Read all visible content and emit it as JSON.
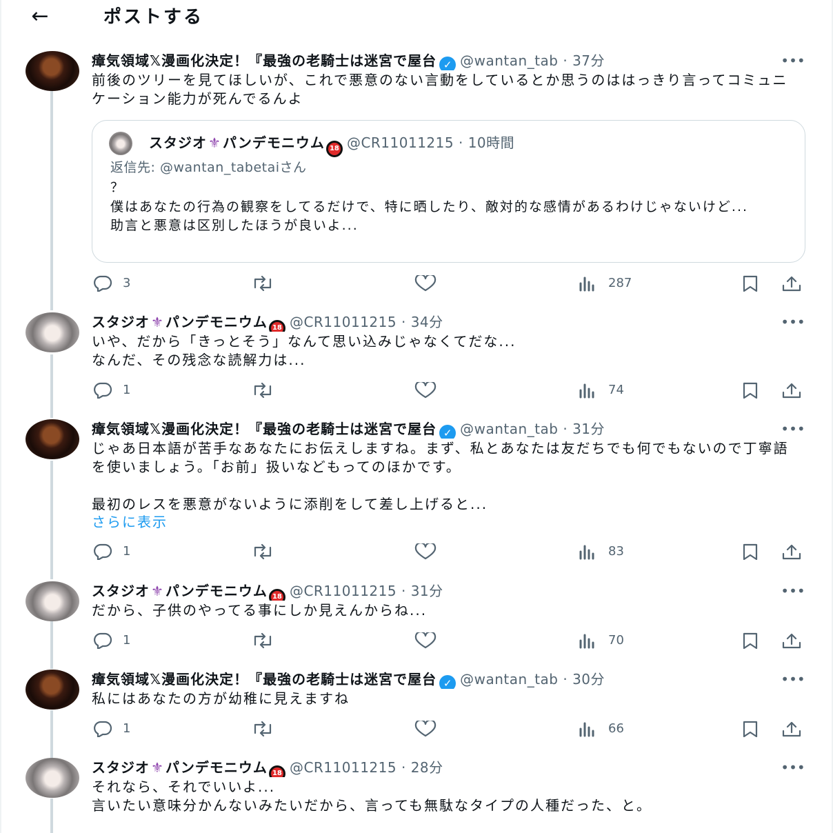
{
  "header": {
    "back_icon": "arrow-left-icon",
    "title": "ポストする"
  },
  "users": {
    "a": {
      "name": "瘴気領域𝕏漫画化決定！『最強の老騎士は迷宮で屋台",
      "verified": true
    },
    "b": {
      "name": "スタジオ⚜️パンデモニウム",
      "badge": "18",
      "handle": "@CR11011215"
    }
  },
  "posts": [
    {
      "name": "瘴気領域𝕏漫画化決定！『最強の老騎士は迷宮で屋台",
      "handle": "@wantan_tab",
      "time": "37分",
      "text": "前後のツリーを見てほしいが、これで悪意のない言動をしているとか思うのははっきり言ってコミュニケーション能力が死んでるんよ",
      "quote": {
        "name": "スタジオ⚜️パンデモニウム",
        "handle": "@CR11011215",
        "time": "10時間",
        "reply_prefix": "返信先: ",
        "reply_to": "@wantan_tabetai",
        "reply_suffix": "さん",
        "text": "？\n僕はあなたの行為の観察をしてるだけで、特に晒したり、敵対的な感情があるわけじゃないけど...\n助言と悪意は区別したほうが良いよ..."
      },
      "replies": "3",
      "retweets": "",
      "likes": "",
      "views": "287"
    },
    {
      "name": "スタジオ⚜️パンデモニウム",
      "handle": "@CR11011215",
      "time": "34分",
      "text": "いや、だから「きっとそう」なんて思い込みじゃなくてだな...\nなんだ、その残念な読解力は...",
      "replies": "1",
      "retweets": "",
      "likes": "",
      "views": "74"
    },
    {
      "name": "瘴気領域𝕏漫画化決定！『最強の老騎士は迷宮で屋台",
      "handle": "@wantan_tab",
      "time": "31分",
      "text": "じゃあ日本語が苦手なあなたにお伝えしますね。まず、私とあなたは友だちでも何でもないので丁寧語を使いましょう。「お前」扱いなどもってのほかです。\n\n最初のレスを悪意がないように添削をして差し上げると...",
      "show_more": "さらに表示",
      "replies": "1",
      "retweets": "",
      "likes": "",
      "views": "83"
    },
    {
      "name": "スタジオ⚜️パンデモニウム",
      "handle": "@CR11011215",
      "time": "31分",
      "text": "だから、子供のやってる事にしか見えんからね...",
      "replies": "1",
      "retweets": "",
      "likes": "",
      "views": "70"
    },
    {
      "name": "瘴気領域𝕏漫画化決定！『最強の老騎士は迷宮で屋台",
      "handle": "@wantan_tab",
      "time": "30分",
      "text": "私にはあなたの方が幼稚に見えますね",
      "replies": "1",
      "retweets": "",
      "likes": "",
      "views": "66"
    },
    {
      "name": "スタジオ⚜️パンデモニウム",
      "handle": "@CR11011215",
      "time": "28分",
      "text": "それなら、それでいいよ...\n言いたい意味分かんないみたいだから、言っても無駄なタイプの人種だった、と。"
    }
  ],
  "colors": {
    "accent": "#1d9bf0",
    "muted": "#536471",
    "text": "#0f1419",
    "thread": "#cfd9de"
  },
  "icons": {
    "reply": "reply-icon",
    "retweet": "retweet-icon",
    "like": "heart-icon",
    "views": "views-icon",
    "bookmark": "bookmark-icon",
    "share": "share-icon",
    "more": "more-icon"
  }
}
